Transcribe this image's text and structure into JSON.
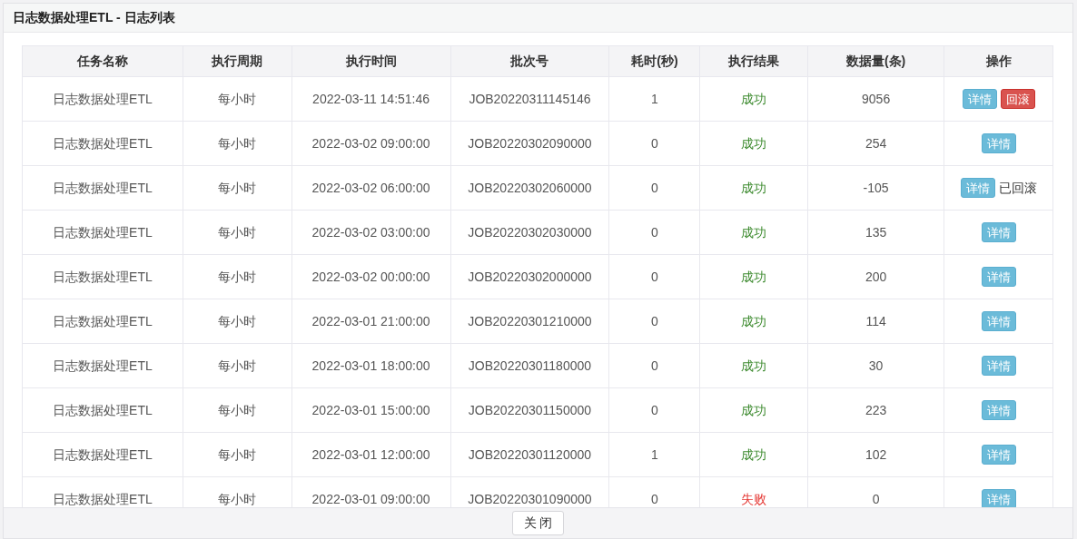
{
  "dialog": {
    "title": "日志数据处理ETL - 日志列表",
    "close_button": "关 闭"
  },
  "table": {
    "columns": [
      "任务名称",
      "执行周期",
      "执行时间",
      "批次号",
      "耗时(秒)",
      "执行结果",
      "数据量(条)",
      "操作"
    ],
    "rows": [
      {
        "name": "日志数据处理ETL",
        "period": "每小时",
        "time": "2022-03-11 14:51:46",
        "batch": "JOB20220311145146",
        "duration": "1",
        "result": {
          "text": "成功",
          "kind": "success"
        },
        "count": "9056",
        "actions": [
          {
            "label": "详情",
            "kind": "info"
          },
          {
            "label": "回滚",
            "kind": "danger"
          }
        ]
      },
      {
        "name": "日志数据处理ETL",
        "period": "每小时",
        "time": "2022-03-02 09:00:00",
        "batch": "JOB20220302090000",
        "duration": "0",
        "result": {
          "text": "成功",
          "kind": "success"
        },
        "count": "254",
        "actions": [
          {
            "label": "详情",
            "kind": "info"
          }
        ]
      },
      {
        "name": "日志数据处理ETL",
        "period": "每小时",
        "time": "2022-03-02 06:00:00",
        "batch": "JOB20220302060000",
        "duration": "0",
        "result": {
          "text": "成功",
          "kind": "success"
        },
        "count": "-105",
        "actions": [
          {
            "label": "详情",
            "kind": "info"
          }
        ],
        "note": "已回滚"
      },
      {
        "name": "日志数据处理ETL",
        "period": "每小时",
        "time": "2022-03-02 03:00:00",
        "batch": "JOB20220302030000",
        "duration": "0",
        "result": {
          "text": "成功",
          "kind": "success"
        },
        "count": "135",
        "actions": [
          {
            "label": "详情",
            "kind": "info"
          }
        ]
      },
      {
        "name": "日志数据处理ETL",
        "period": "每小时",
        "time": "2022-03-02 00:00:00",
        "batch": "JOB20220302000000",
        "duration": "0",
        "result": {
          "text": "成功",
          "kind": "success"
        },
        "count": "200",
        "actions": [
          {
            "label": "详情",
            "kind": "info"
          }
        ]
      },
      {
        "name": "日志数据处理ETL",
        "period": "每小时",
        "time": "2022-03-01 21:00:00",
        "batch": "JOB20220301210000",
        "duration": "0",
        "result": {
          "text": "成功",
          "kind": "success"
        },
        "count": "114",
        "actions": [
          {
            "label": "详情",
            "kind": "info"
          }
        ]
      },
      {
        "name": "日志数据处理ETL",
        "period": "每小时",
        "time": "2022-03-01 18:00:00",
        "batch": "JOB20220301180000",
        "duration": "0",
        "result": {
          "text": "成功",
          "kind": "success"
        },
        "count": "30",
        "actions": [
          {
            "label": "详情",
            "kind": "info"
          }
        ]
      },
      {
        "name": "日志数据处理ETL",
        "period": "每小时",
        "time": "2022-03-01 15:00:00",
        "batch": "JOB20220301150000",
        "duration": "0",
        "result": {
          "text": "成功",
          "kind": "success"
        },
        "count": "223",
        "actions": [
          {
            "label": "详情",
            "kind": "info"
          }
        ]
      },
      {
        "name": "日志数据处理ETL",
        "period": "每小时",
        "time": "2022-03-01 12:00:00",
        "batch": "JOB20220301120000",
        "duration": "1",
        "result": {
          "text": "成功",
          "kind": "success"
        },
        "count": "102",
        "actions": [
          {
            "label": "详情",
            "kind": "info"
          }
        ]
      },
      {
        "name": "日志数据处理ETL",
        "period": "每小时",
        "time": "2022-03-01 09:00:00",
        "batch": "JOB20220301090000",
        "duration": "0",
        "result": {
          "text": "失败",
          "kind": "failure"
        },
        "count": "0",
        "actions": [
          {
            "label": "详情",
            "kind": "info"
          }
        ]
      }
    ]
  }
}
